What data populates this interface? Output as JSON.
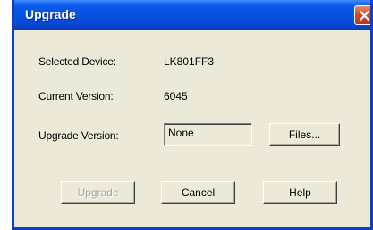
{
  "window": {
    "title": "Upgrade",
    "close_icon": "close-icon"
  },
  "fields": {
    "selected_device_label": "Selected Device:",
    "selected_device_value": "LK801FF3",
    "current_version_label": "Current Version:",
    "current_version_value": "6045",
    "upgrade_version_label": "Upgrade Version:",
    "upgrade_version_value": "None"
  },
  "buttons": {
    "files": "Files...",
    "upgrade": "Upgrade",
    "cancel": "Cancel",
    "help": "Help"
  },
  "colors": {
    "titlebar": "#0651e0",
    "dialog_bg": "#ece9d8",
    "close_button": "#d8482a",
    "disabled_text": "#a9a698"
  }
}
